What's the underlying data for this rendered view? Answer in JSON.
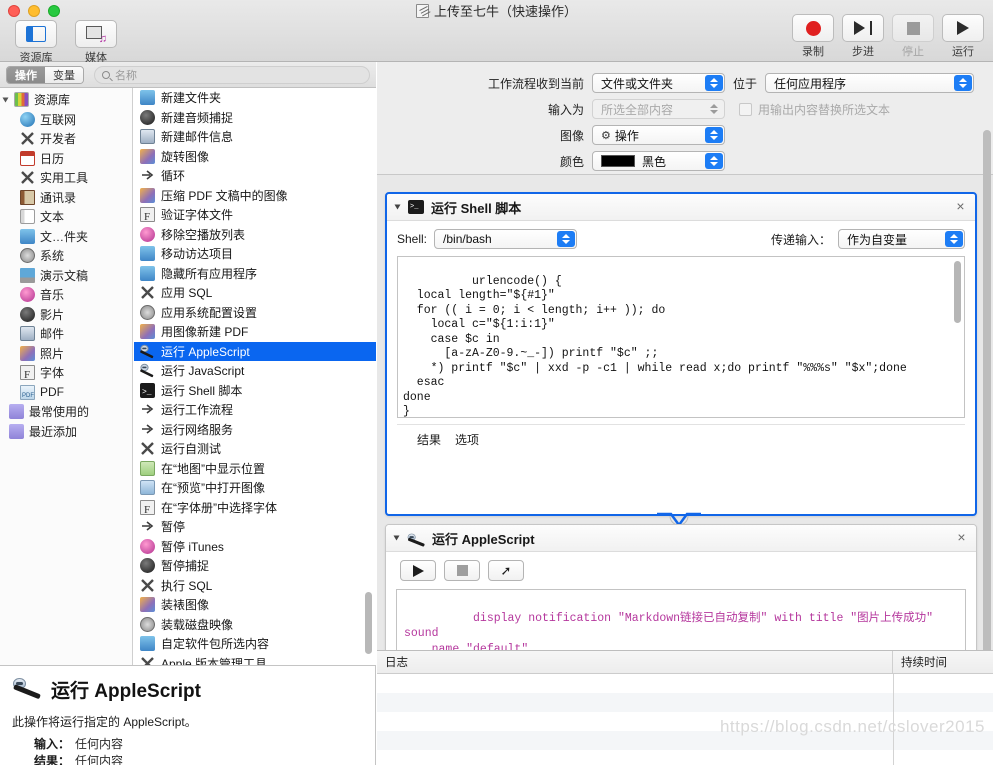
{
  "window": {
    "title": "上传至七牛（快速操作）",
    "doc_icon": "applescript-document-icon"
  },
  "toolbar": {
    "left_items": [
      {
        "label": "资源库",
        "icon": "library-icon"
      },
      {
        "label": "媒体",
        "icon": "media-icon"
      }
    ],
    "right_controls": [
      {
        "label": "录制",
        "icon": "record-dot-icon",
        "enabled": true
      },
      {
        "label": "步进",
        "icon": "step-forward-icon",
        "enabled": true
      },
      {
        "label": "停止",
        "icon": "stop-square-icon",
        "enabled": false
      },
      {
        "label": "运行",
        "icon": "play-triangle-icon",
        "enabled": true
      }
    ]
  },
  "library_pane": {
    "tabs": [
      {
        "label": "操作",
        "selected": true
      },
      {
        "label": "变量",
        "selected": false
      }
    ],
    "search": {
      "placeholder": "名称",
      "value": "",
      "icon": "search-icon"
    },
    "tree": {
      "root": {
        "label": "资源库",
        "icon": "library-color-icon",
        "expanded": true
      },
      "items": [
        {
          "label": "互联网",
          "icon": "globe-icon"
        },
        {
          "label": "开发者",
          "icon": "developer-x-icon"
        },
        {
          "label": "日历",
          "icon": "calendar-icon"
        },
        {
          "label": "实用工具",
          "icon": "utilities-x-icon"
        },
        {
          "label": "通讯录",
          "icon": "contacts-icon"
        },
        {
          "label": "文本",
          "icon": "text-icon"
        },
        {
          "label": "文…件夹",
          "icon": "finder-icon"
        },
        {
          "label": "系统",
          "icon": "system-icon"
        },
        {
          "label": "演示文稿",
          "icon": "keynote-icon"
        },
        {
          "label": "音乐",
          "icon": "music-icon"
        },
        {
          "label": "影片",
          "icon": "quicktime-icon"
        },
        {
          "label": "邮件",
          "icon": "mail-icon"
        },
        {
          "label": "照片",
          "icon": "photos-icon"
        },
        {
          "label": "字体",
          "icon": "font-icon"
        },
        {
          "label": "PDF",
          "icon": "pdf-icon"
        }
      ],
      "smart_groups": [
        {
          "label": "最常使用的",
          "icon": "smart-folder-icon"
        },
        {
          "label": "最近添加",
          "icon": "smart-folder-icon"
        }
      ]
    },
    "actions": [
      {
        "label": "新建文件夹",
        "icon": "finder-icon",
        "selected": false
      },
      {
        "label": "新建音频捕捉",
        "icon": "quicktime-icon",
        "selected": false
      },
      {
        "label": "新建邮件信息",
        "icon": "mail-icon",
        "selected": false
      },
      {
        "label": "旋转图像",
        "icon": "photos-icon",
        "selected": false
      },
      {
        "label": "循环",
        "icon": "automator-icon",
        "selected": false
      },
      {
        "label": "压缩 PDF 文稿中的图像",
        "icon": "photos-icon",
        "selected": false
      },
      {
        "label": "验证字体文件",
        "icon": "font-icon",
        "selected": false
      },
      {
        "label": "移除空播放列表",
        "icon": "music-icon",
        "selected": false
      },
      {
        "label": "移动访达项目",
        "icon": "finder-icon",
        "selected": false
      },
      {
        "label": "隐藏所有应用程序",
        "icon": "finder-icon",
        "selected": false
      },
      {
        "label": "应用 SQL",
        "icon": "developer-x-icon",
        "selected": false
      },
      {
        "label": "应用系统配置设置",
        "icon": "system-icon",
        "selected": false
      },
      {
        "label": "用图像新建 PDF",
        "icon": "photos-icon",
        "selected": false
      },
      {
        "label": "运行 AppleScript",
        "icon": "applescript-icon",
        "selected": true
      },
      {
        "label": "运行 JavaScript",
        "icon": "applescript-icon",
        "selected": false
      },
      {
        "label": "运行 Shell 脚本",
        "icon": "terminal-icon",
        "selected": false
      },
      {
        "label": "运行工作流程",
        "icon": "automator-icon",
        "selected": false
      },
      {
        "label": "运行网络服务",
        "icon": "automator-icon",
        "selected": false
      },
      {
        "label": "运行自测试",
        "icon": "developer-x-icon",
        "selected": false
      },
      {
        "label": "在“地图”中显示位置",
        "icon": "maps-icon",
        "selected": false
      },
      {
        "label": "在“预览”中打开图像",
        "icon": "preview-icon",
        "selected": false
      },
      {
        "label": "在“字体册”中选择字体",
        "icon": "font-icon",
        "selected": false
      },
      {
        "label": "暂停",
        "icon": "automator-icon",
        "selected": false
      },
      {
        "label": "暂停 iTunes",
        "icon": "music-icon",
        "selected": false
      },
      {
        "label": "暂停捕捉",
        "icon": "quicktime-icon",
        "selected": false
      },
      {
        "label": "执行 SQL",
        "icon": "developer-x-icon",
        "selected": false
      },
      {
        "label": "装裱图像",
        "icon": "photos-icon",
        "selected": false
      },
      {
        "label": "装载磁盘映像",
        "icon": "system-icon",
        "selected": false
      },
      {
        "label": "自定软件包所选内容",
        "icon": "finder-icon",
        "selected": false
      },
      {
        "label": "Apple 版本管理工具",
        "icon": "developer-x-icon",
        "selected": false
      }
    ]
  },
  "info_panel": {
    "icon": "applescript-icon",
    "title": "运行 AppleScript",
    "description": "此操作将运行指定的 AppleScript。",
    "fields": [
      {
        "label": "输入：",
        "value": "任何内容"
      },
      {
        "label": "结果：",
        "value": "任何内容"
      }
    ]
  },
  "workflow_settings": {
    "rows": [
      {
        "label": "工作流程收到当前",
        "value": "文件或文件夹",
        "enabled": true,
        "second_label": "位于",
        "second_value": "任何应用程序",
        "second_enabled": true
      },
      {
        "label": "输入为",
        "value": "所选全部内容",
        "enabled": false,
        "checkbox_label": "用输出内容替换所选文本",
        "checkbox_checked": false,
        "checkbox_enabled": false
      },
      {
        "label": "图像",
        "value": "操作",
        "enabled": true,
        "icon": "gear-icon"
      },
      {
        "label": "颜色",
        "value": "黑色",
        "enabled": true,
        "swatch": "#000000"
      }
    ]
  },
  "actions_cards": [
    {
      "id": "shell-card",
      "title": "运行 Shell 脚本",
      "icon": "terminal-icon",
      "focused": true,
      "close_icon": "close-icon",
      "shell_label": "Shell:",
      "shell_value": "/bin/bash",
      "pass_input_label": "传递输入：",
      "pass_input_value": "作为自变量",
      "code": "urlencode() {\n  local length=\"${#1}\"\n  for (( i = 0; i < length; i++ )); do\n    local c=\"${1:i:1}\"\n    case $c in\n      [a-zA-Z0-9.~_-]) printf \"$c\" ;;\n    *) printf \"$c\" | xxd -p -c1 | while read x;do printf \"%%%s\" \"$x\";done\n  esac\ndone\n}\n\nfor f in \"$@\"",
      "tabs": [
        "结果",
        "选项"
      ]
    },
    {
      "id": "applescript-card",
      "title": "运行 AppleScript",
      "icon": "applescript-icon",
      "focused": false,
      "close_icon": "close-icon",
      "buttons": [
        {
          "name": "run-script-button",
          "icon": "play-triangle-icon"
        },
        {
          "name": "stop-script-button",
          "icon": "stop-square-icon"
        },
        {
          "name": "compile-script-button",
          "icon": "hammer-icon"
        }
      ],
      "code": "display notification \"Markdown链接已自动复制\" with title \"图片上传成功\" sound\n    name \"default\""
    }
  ],
  "log_panel": {
    "columns": [
      "日志",
      "持续时间"
    ],
    "rows": []
  },
  "watermark": "https://blog.csdn.net/cslover2015",
  "colors": {
    "selection_blue": "#0a66f0",
    "focus_border": "#1166e8",
    "popup_accent": "#1d7df5",
    "record_red": "#e02020",
    "applescript_text": "#b5379d"
  }
}
